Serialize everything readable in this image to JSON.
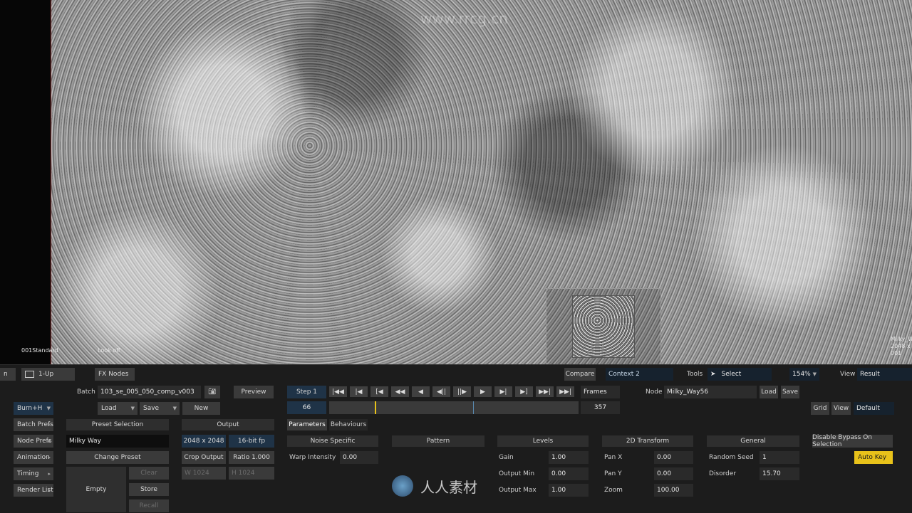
{
  "viewport": {
    "left_label": "001Standard",
    "right_label": "Look off",
    "node_overlay": "Milky_Wa\n2048 x 2\n001"
  },
  "topbar": {
    "first_tab": "n",
    "layout": "1-Up",
    "fx_nodes": "FX Nodes",
    "compare": "Compare",
    "context": "Context 2",
    "tools": "Tools",
    "select": "Select",
    "zoom": "154%",
    "view_label": "View",
    "view_value": "Result"
  },
  "batch": {
    "label": "Batch",
    "name": "103_se_005_050_comp_v003",
    "preview": "Preview",
    "load": "Load",
    "save": "Save",
    "new": "New"
  },
  "transport": {
    "step": "Step 1",
    "buttons": [
      "|◀◀",
      "|◀",
      "[◀",
      "◀◀",
      "◀",
      "◀||",
      "||▶",
      "▶",
      "▶|",
      "▶]",
      "▶▶|",
      "▶▶|"
    ],
    "frames": "Frames",
    "current_frame": "66",
    "end_frame": "357"
  },
  "node": {
    "label": "Node",
    "name": "Milky_Way56",
    "load": "Load",
    "save": "Save",
    "grid": "Grid",
    "view": "View",
    "default": "Default"
  },
  "left_menu": {
    "burn": "Burn+H",
    "items": [
      "Batch Prefs",
      "Node Prefs",
      "Animation",
      "Timing",
      "Render List"
    ]
  },
  "preset": {
    "header": "Preset Selection",
    "value": "Milky Way",
    "change": "Change Preset",
    "empty": "Empty",
    "clear": "Clear",
    "store": "Store",
    "recall": "Recall"
  },
  "output": {
    "header": "Output",
    "resolution": "2048 x 2048",
    "bitdepth": "16-bit fp",
    "crop": "Crop Output",
    "ratio": "Ratio 1.000",
    "w": "W 1024",
    "h": "H 1024"
  },
  "tabs": [
    "Parameters",
    "Behaviours"
  ],
  "noise_specific": {
    "header": "Noise Specific",
    "warp_label": "Warp Intensity",
    "warp_value": "0.00"
  },
  "pattern": {
    "header": "Pattern"
  },
  "levels": {
    "header": "Levels",
    "gain_label": "Gain",
    "gain_value": "1.00",
    "min_label": "Output Min",
    "min_value": "0.00",
    "max_label": "Output Max",
    "max_value": "1.00"
  },
  "transform": {
    "header": "2D Transform",
    "panx_label": "Pan X",
    "panx_value": "0.00",
    "pany_label": "Pan Y",
    "pany_value": "0.00",
    "zoom_label": "Zoom",
    "zoom_value": "100.00"
  },
  "general": {
    "header": "General",
    "seed_label": "Random Seed",
    "seed_value": "1",
    "disorder_label": "Disorder",
    "disorder_value": "15.70"
  },
  "right": {
    "bypass": "Disable Bypass On Selection",
    "autokey": "Auto Key",
    "autokey_color": "#e8c21a"
  },
  "watermark": {
    "site": "www.rrcg.cn",
    "brand": "人人素材"
  }
}
